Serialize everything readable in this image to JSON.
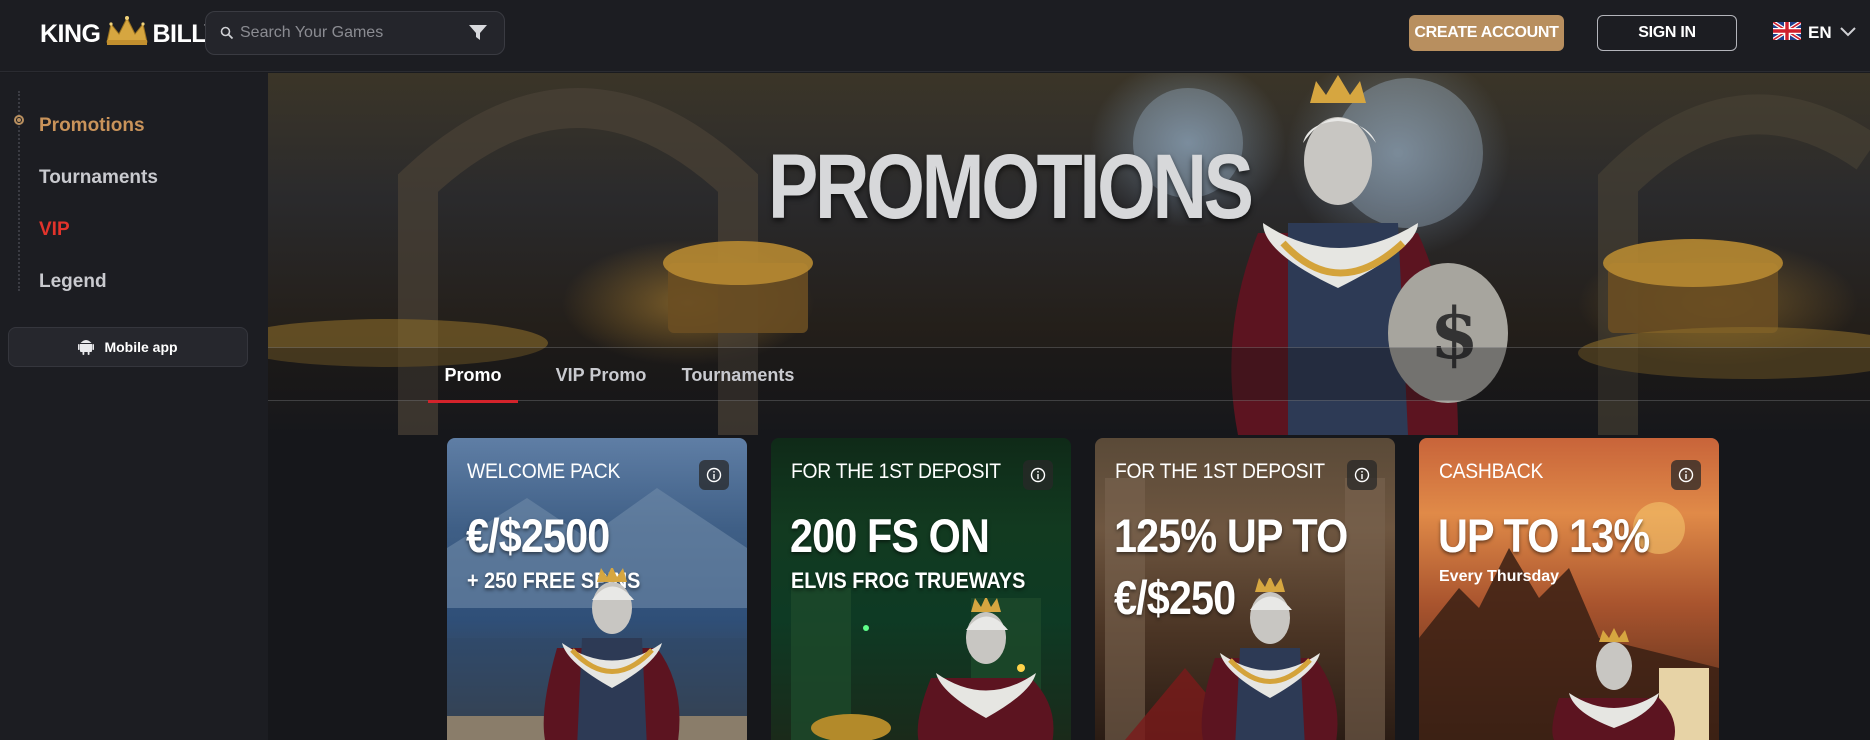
{
  "header": {
    "logo_left": "KING",
    "logo_right": "BILLY",
    "search_placeholder": "Search Your Games",
    "create_account": "CREATE ACCOUNT",
    "sign_in": "SIGN IN",
    "language": "EN"
  },
  "sidebar": {
    "items": [
      {
        "label": "Promotions",
        "color": "#c9935a"
      },
      {
        "label": "Tournaments",
        "color": "#c9cacf"
      },
      {
        "label": "VIP",
        "color": "#e2332b"
      },
      {
        "label": "Legend",
        "color": "#c9cacf"
      }
    ],
    "mobile_app": "Mobile app"
  },
  "hero": {
    "title": "PROMOTIONS"
  },
  "tabs": [
    {
      "label": "Promo",
      "active": true
    },
    {
      "label": "VIP Promo",
      "active": false
    },
    {
      "label": "Tournaments",
      "active": false
    }
  ],
  "cards": [
    {
      "label": "WELCOME PACK",
      "big": "€/$2500",
      "sub": "+ 250 FREE SPINS"
    },
    {
      "label": "FOR THE 1ST DEPOSIT",
      "big": "200 FS ON",
      "sub": "ELVIS FROG TRUEWAYS"
    },
    {
      "label": "FOR THE 1ST DEPOSIT",
      "big": "125% UP TO",
      "big2": "€/$250"
    },
    {
      "label": "CASHBACK",
      "big": "UP TO 13%",
      "small": "Every Thursday"
    }
  ],
  "colors": {
    "accent_gold": "#b88f5f",
    "vip_red": "#e2332b",
    "tab_underline": "#d4232b"
  }
}
